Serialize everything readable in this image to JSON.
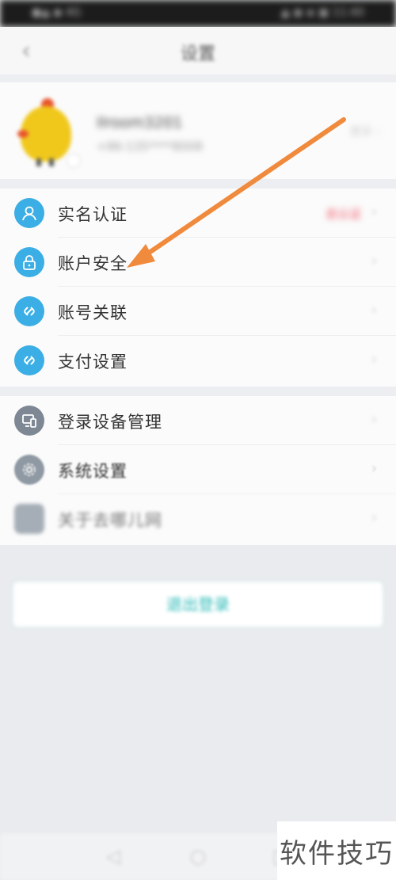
{
  "status_bar": {
    "left": "●▲ ◆ 4G",
    "right": "▲ ◉ ◈ ▣ 11:40"
  },
  "nav": {
    "title": "设置",
    "back_icon": "chevron-left-icon"
  },
  "profile": {
    "name": "Ilroom3201",
    "phone": "+86-135****8008",
    "more": "更多 ›"
  },
  "group1": {
    "items": [
      {
        "label": "实名认证",
        "icon": "user-id-icon",
        "status": "去认证"
      },
      {
        "label": "账户安全",
        "icon": "lock-icon"
      },
      {
        "label": "账号关联",
        "icon": "link-icon"
      },
      {
        "label": "支付设置",
        "icon": "link-icon"
      }
    ]
  },
  "group2": {
    "items": [
      {
        "label": "登录设备管理",
        "icon": "devices-icon"
      },
      {
        "label": "系统设置",
        "icon": "gear-icon"
      },
      {
        "label": "关于去哪儿网",
        "icon": "app-logo-icon"
      }
    ]
  },
  "logout": {
    "label": "退出登录"
  },
  "sys_nav": {
    "back": "◁",
    "home": "○",
    "recent": "□"
  },
  "watermark": {
    "text": "软件技巧"
  },
  "colors": {
    "accent_blue": "#3aaee5",
    "icon_gray": "#7d8894",
    "logout_teal": "#2bbab7",
    "arrow_orange": "#f08a3c",
    "warn_red": "#ef4a5a"
  }
}
